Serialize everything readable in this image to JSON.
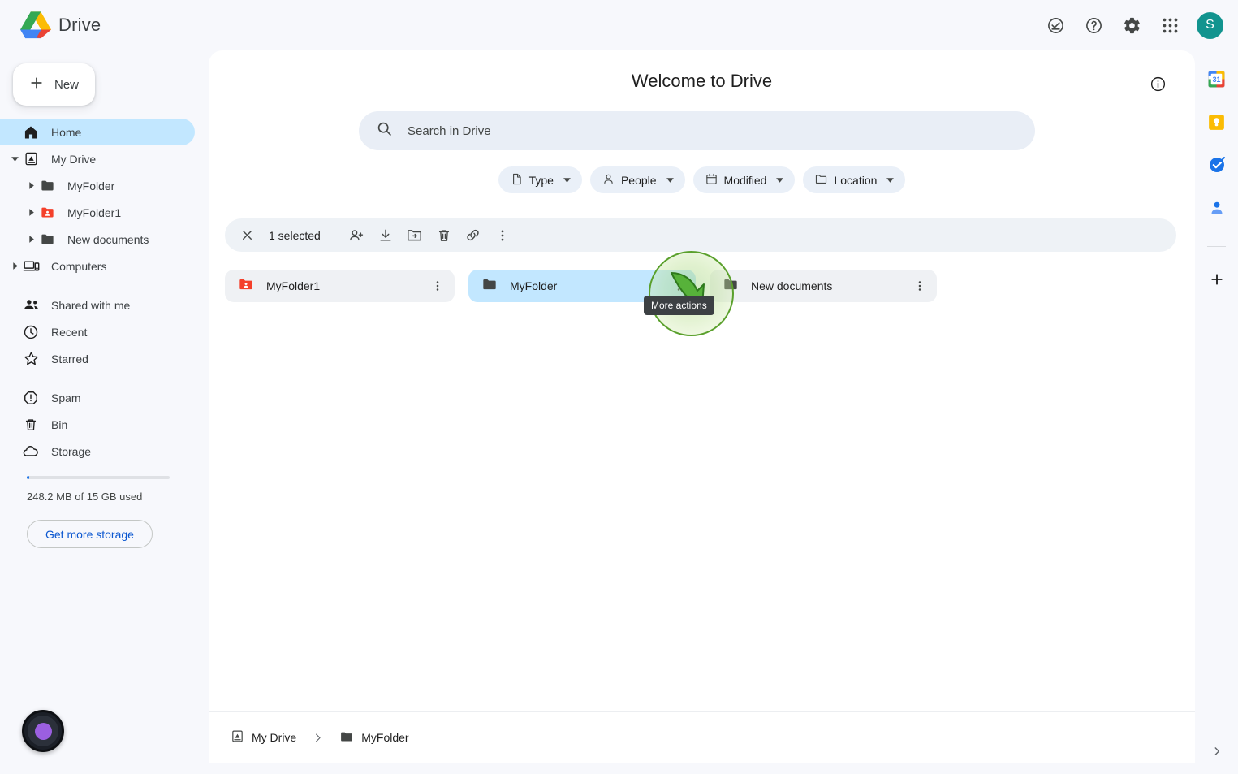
{
  "app": {
    "brand_name": "Drive",
    "logo_icon": "google-drive-logo"
  },
  "topbar": {
    "icons": [
      {
        "name": "activity-check-icon",
        "label": "Activity"
      },
      {
        "name": "help-icon",
        "label": "Support"
      },
      {
        "name": "settings-gear-icon",
        "label": "Settings"
      },
      {
        "name": "apps-grid-icon",
        "label": "Google apps"
      }
    ],
    "avatar_initial": "S",
    "avatar_color": "#12948f"
  },
  "sidebar": {
    "new_button": {
      "label": "New",
      "icon": "plus-icon"
    },
    "items": [
      {
        "label": "Home",
        "icon": "home-icon",
        "level": 1,
        "active": true,
        "caret": ""
      },
      {
        "label": "My Drive",
        "icon": "my-drive-icon",
        "level": 1,
        "active": false,
        "caret": "down"
      },
      {
        "label": "MyFolder",
        "icon": "folder-icon",
        "level": 2,
        "active": false,
        "caret": "right"
      },
      {
        "label": "MyFolder1",
        "icon": "shared-folder-icon",
        "level": 2,
        "active": false,
        "caret": "right"
      },
      {
        "label": "New documents",
        "icon": "folder-icon",
        "level": 2,
        "active": false,
        "caret": "right"
      },
      {
        "label": "Computers",
        "icon": "computer-icon",
        "level": 1,
        "active": false,
        "caret": "right"
      },
      {
        "label": "Shared with me",
        "icon": "people-icon",
        "level": 1,
        "active": false,
        "caret": ""
      },
      {
        "label": "Recent",
        "icon": "clock-icon",
        "level": 1,
        "active": false,
        "caret": ""
      },
      {
        "label": "Starred",
        "icon": "star-icon",
        "level": 1,
        "active": false,
        "caret": ""
      },
      {
        "label": "Spam",
        "icon": "spam-icon",
        "level": 1,
        "active": false,
        "caret": ""
      },
      {
        "label": "Bin",
        "icon": "trash-icon",
        "level": 1,
        "active": false,
        "caret": ""
      },
      {
        "label": "Storage",
        "icon": "cloud-icon",
        "level": 1,
        "active": false,
        "caret": ""
      }
    ],
    "storage": {
      "used_text": "248.2 MB of 15 GB used",
      "percent": 1.6,
      "button_label": "Get more storage",
      "accent_color": "#1a73e8"
    }
  },
  "main": {
    "title": "Welcome to Drive",
    "info_icon": "info-icon",
    "search": {
      "placeholder": "Search in Drive",
      "value": "",
      "icon": "search-icon"
    },
    "filter_chips": [
      {
        "label": "Type",
        "icon": "document-icon"
      },
      {
        "label": "People",
        "icon": "person-icon"
      },
      {
        "label": "Modified",
        "icon": "calendar-icon"
      },
      {
        "label": "Location",
        "icon": "folder-outline-icon"
      }
    ],
    "selection_toolbar": {
      "close_icon": "close-icon",
      "count_label": "1 selected",
      "actions": [
        {
          "name": "share-icon",
          "label": "Share"
        },
        {
          "name": "download-icon",
          "label": "Download"
        },
        {
          "name": "move-to-folder-icon",
          "label": "Move"
        },
        {
          "name": "delete-icon",
          "label": "Remove"
        },
        {
          "name": "copy-link-icon",
          "label": "Copy link"
        },
        {
          "name": "more-actions-icon",
          "label": "More actions"
        }
      ]
    },
    "cards": [
      {
        "name": "MyFolder1",
        "icon": "shared-folder-icon",
        "selected": false
      },
      {
        "name": "MyFolder",
        "icon": "folder-icon",
        "selected": true
      },
      {
        "name": "New documents",
        "icon": "folder-icon",
        "selected": false
      }
    ],
    "tooltip": "More actions",
    "breadcrumb": [
      {
        "label": "My Drive",
        "icon": "my-drive-icon"
      },
      {
        "label": "MyFolder",
        "icon": "folder-icon"
      }
    ]
  },
  "right_rail": {
    "icons": [
      {
        "name": "google-calendar-icon",
        "label": "Calendar",
        "badge": "31"
      },
      {
        "name": "google-keep-icon",
        "label": "Keep"
      },
      {
        "name": "google-tasks-icon",
        "label": "Tasks"
      },
      {
        "name": "google-contacts-icon",
        "label": "Contacts"
      }
    ],
    "add_label": "Get add-ons",
    "expand_icon": "chevron-right-icon"
  },
  "overlay": {
    "record_button": "screen-record-button",
    "record_dot_color": "#9b5fe0"
  }
}
